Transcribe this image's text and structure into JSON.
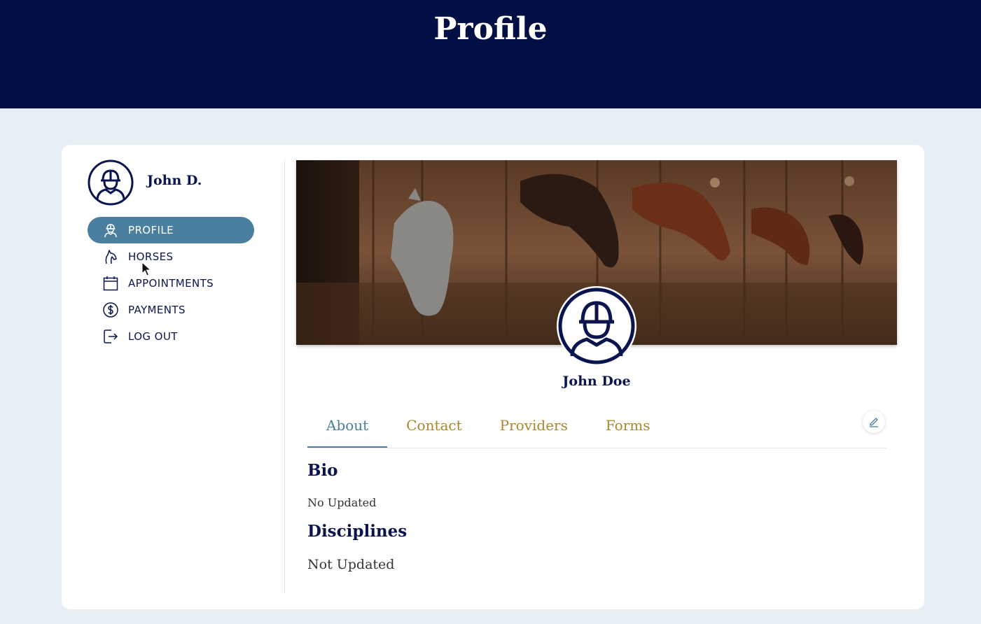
{
  "header": {
    "title": "Profile"
  },
  "user": {
    "short_name": "John D.",
    "full_name": "John Doe"
  },
  "sidebar": {
    "items": [
      {
        "label": "PROFILE",
        "icon": "rider-icon",
        "active": true
      },
      {
        "label": "HORSES",
        "icon": "horse-icon",
        "active": false
      },
      {
        "label": "APPOINTMENTS",
        "icon": "calendar-icon",
        "active": false
      },
      {
        "label": "PAYMENTS",
        "icon": "dollar-icon",
        "active": false
      },
      {
        "label": "LOG OUT",
        "icon": "logout-icon",
        "active": false
      }
    ]
  },
  "tabs": [
    {
      "label": "About",
      "active": true
    },
    {
      "label": "Contact",
      "active": false
    },
    {
      "label": "Providers",
      "active": false
    },
    {
      "label": "Forms",
      "active": false
    }
  ],
  "about": {
    "bio_heading": "Bio",
    "bio_text": "No Updated",
    "disciplines_heading": "Disciplines",
    "disciplines_text": "Not Updated"
  },
  "colors": {
    "header_bg": "#020f45",
    "accent": "#4a7f9f",
    "tab_inactive": "#a8872f",
    "navy_text": "#0a1550",
    "page_bg": "#e8eef5"
  }
}
